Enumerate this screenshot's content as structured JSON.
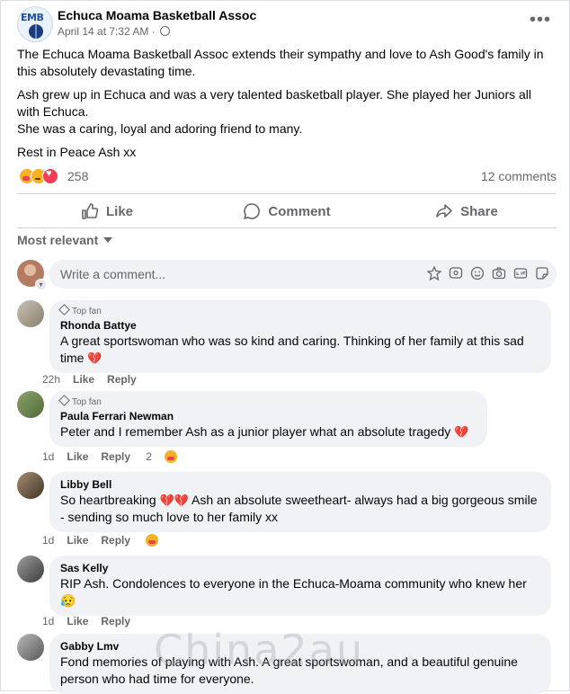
{
  "post": {
    "page_name": "Echuca Moama Basketball Assoc",
    "avatar_text": "EMB",
    "timestamp": "April 14 at 7:32 AM",
    "separator": "·",
    "paragraphs": [
      "The Echuca Moama Basketball Assoc extends their sympathy and love to Ash Good's family in this absolutely devastating time.",
      "Ash grew up in Echuca and was a very talented basketball player. She played her Juniors all with Echuca.",
      "She was a caring, loyal and adoring friend to many.",
      "Rest in Peace Ash xx"
    ],
    "reactions_count": "258",
    "comments_count": "12 comments",
    "reaction_icons": [
      "care-icon",
      "sad-icon",
      "love-icon"
    ]
  },
  "actions": {
    "like": "Like",
    "comment": "Comment",
    "share": "Share"
  },
  "sort_label": "Most relevant",
  "composer": {
    "placeholder": "Write a comment..."
  },
  "comments": [
    {
      "badge": "Top fan",
      "author": "Rhonda Battye",
      "text": "A great sportswoman who was so kind and caring. Thinking of her family at this sad time",
      "emoji": "💔",
      "time": "22h",
      "like": "Like",
      "reply": "Reply",
      "reaction_count": ""
    },
    {
      "badge": "Top fan",
      "author": "Paula Ferrari Newman",
      "text": "Peter and I remember Ash as a junior player what an absolute tragedy",
      "emoji": "💔",
      "time": "1d",
      "like": "Like",
      "reply": "Reply",
      "reaction_count": "2"
    },
    {
      "badge": "",
      "author": "Libby Bell",
      "text_a": "So heartbreaking",
      "emoji": "💔💔",
      "text_b": "Ash an absolute sweetheart- always had a big gorgeous smile - sending so much love to her family xx",
      "time": "1d",
      "like": "Like",
      "reply": "Reply",
      "reaction_count": ""
    },
    {
      "badge": "",
      "author": "Sas Kelly",
      "text": "RIP Ash. Condolences to everyone in the Echuca-Moama community who knew her",
      "emoji": "😥",
      "time": "1d",
      "like": "Like",
      "reply": "Reply",
      "reaction_count": ""
    },
    {
      "badge": "",
      "author": "Gabby Lmv",
      "text": "Fond memories of playing with Ash. A great sportswoman, and a beautiful genuine person who had time for everyone."
    }
  ],
  "watermark": "China2au",
  "colors": {
    "secondary_text": "#65676b",
    "bubble": "#f0f2f5",
    "heart": "#e0245e"
  }
}
